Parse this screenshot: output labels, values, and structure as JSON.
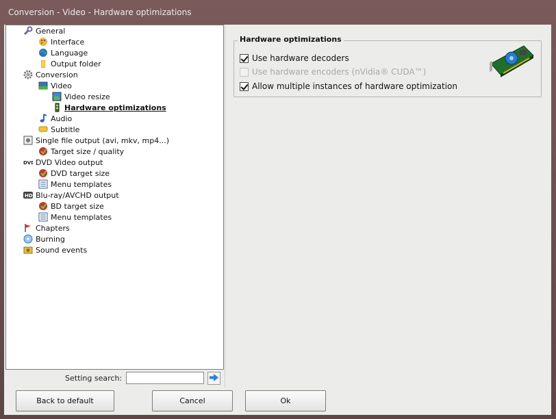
{
  "window": {
    "title": "Conversion - Video - Hardware optimizations"
  },
  "tree": {
    "items": [
      {
        "label": "General",
        "icon": "wrench-icon"
      },
      {
        "label": "Interface",
        "icon": "palette-icon"
      },
      {
        "label": "Language",
        "icon": "globe-icon"
      },
      {
        "label": "Output folder",
        "icon": "folder-icon"
      },
      {
        "label": "Conversion",
        "icon": "gear-icon"
      },
      {
        "label": "Video",
        "icon": "video-icon"
      },
      {
        "label": "Video resize",
        "icon": "resize-icon"
      },
      {
        "label": "Hardware optimizations",
        "icon": "chip-icon"
      },
      {
        "label": "Audio",
        "icon": "music-note-icon"
      },
      {
        "label": "Subtitle",
        "icon": "subtitle-icon"
      },
      {
        "label": "Single file output (avi, mkv, mp4...)",
        "icon": "film-file-icon"
      },
      {
        "label": "Target size / quality",
        "icon": "target-icon"
      },
      {
        "label": "DVD Video output",
        "icon": "dvd-icon"
      },
      {
        "label": "DVD target size",
        "icon": "target-icon"
      },
      {
        "label": "Menu templates",
        "icon": "menu-template-icon"
      },
      {
        "label": "Blu-ray/AVCHD output",
        "icon": "hd-icon"
      },
      {
        "label": "BD target size",
        "icon": "target-icon"
      },
      {
        "label": "Menu templates",
        "icon": "menu-template-icon"
      },
      {
        "label": "Chapters",
        "icon": "flag-icon"
      },
      {
        "label": "Burning",
        "icon": "disc-burn-icon"
      },
      {
        "label": "Sound events",
        "icon": "speaker-icon"
      }
    ],
    "selected": "Hardware optimizations"
  },
  "search": {
    "label": "Setting search:",
    "value": ""
  },
  "panel": {
    "group_title": "Hardware optimizations",
    "options": [
      {
        "label": "Use hardware decoders",
        "checked": true,
        "enabled": true
      },
      {
        "label": "Use hardware encoders (nVidia® CUDA™)",
        "checked": false,
        "enabled": false
      },
      {
        "label": "Allow multiple instances of hardware optimization",
        "checked": true,
        "enabled": true
      }
    ]
  },
  "buttons": {
    "back": "Back to default",
    "cancel": "Cancel",
    "ok": "Ok"
  },
  "colors": {
    "selected_text": "#111111",
    "disabled_text": "#a8a8a8",
    "window_frame": "#6b5252"
  }
}
